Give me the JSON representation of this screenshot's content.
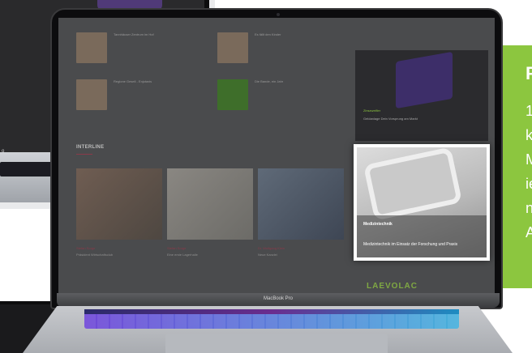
{
  "rear_laptop": {
    "label": "o"
  },
  "side_card": {
    "title": "P",
    "lines": [
      "1",
      "k",
      "M",
      "ie",
      "n",
      "A"
    ]
  },
  "laptop": {
    "model_label": "MacBook Pro"
  },
  "webpage": {
    "articles": [
      {
        "title": "Tannhäuser Zentrum im Hof",
        "category": ""
      },
      {
        "title": "Es fällt den Kinder",
        "category": ""
      },
      {
        "title": "Regione Gesell - Enjotaxis",
        "category": ""
      },
      {
        "title": "Die Bande, ein Jahr",
        "category": ""
      }
    ],
    "section_title": "INTERLINE",
    "photos": [
      {
        "caption_label": "Stefan Sorge",
        "caption_text": "Präsident Wirtschaftsclub"
      },
      {
        "caption_label": "Stefan Sorge",
        "caption_text": "Eine erste Lagerhalle"
      },
      {
        "caption_label": "Dr. Wolfgang Klein",
        "caption_text": "Neue Kanzlei"
      }
    ],
    "ad_box": {
      "category": "Zinszweifler",
      "text": "Geldanlage Dein Vorsprung am Markt"
    },
    "featured": {
      "category": "Medizintechnik",
      "text": "Medizintechnik im Einsatz der Forschung und Praxis"
    },
    "logo_text": "LAEVOLAC"
  }
}
